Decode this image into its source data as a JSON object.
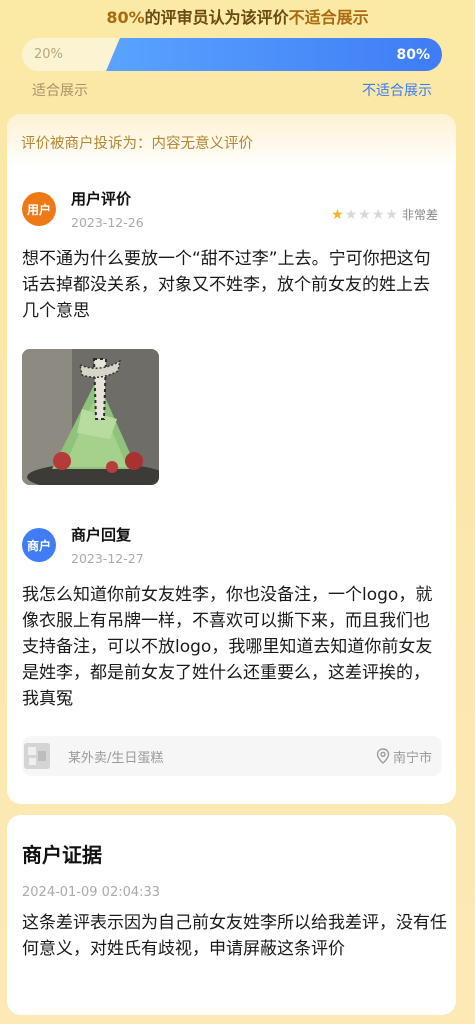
{
  "header": {
    "pct": "80%",
    "text": "的评审员认为该评价",
    "verdict": "不适合展示"
  },
  "vote": {
    "suitable_pct_label": "20%",
    "unsuitable_pct_label": "80%",
    "suitable_fraction": 0.2,
    "unsuitable_fraction": 0.8,
    "suitable_label": "适合展示",
    "unsuitable_label": "不适合展示"
  },
  "review": {
    "complaint": "评价被商户投诉为：内容无意义评价",
    "avatar_text": "用户",
    "name": "用户评价",
    "date": "2023-12-26",
    "rating": 1,
    "rating_max": 5,
    "rating_text": "非常差",
    "text": "想不通为什么要放一个“甜不过李”上去。宁可你把这句话去掉都没关系，对象又不姓李，放个前女友的姓上去几个意思"
  },
  "reply": {
    "avatar_text": "商户",
    "name": "商户回复",
    "date": "2023-12-27",
    "text": "我怎么知道你前女友姓李，你也没备注，一个logo，就像衣服上有吊牌一样，不喜欢可以撕下来，而且我们也支持备注，可以不放logo，我哪里知道去知道你前女友是姓李，都是前女友了姓什么还重要么，这差评挨的，我真冤"
  },
  "shop": {
    "name": "某外卖/生日蛋糕",
    "location": "南宁市"
  },
  "evidence": {
    "title": "商户证据",
    "date": "2024-01-09 02:04:33",
    "text": "这条差评表示因为自己前女友姓李所以给我差评，没有任何意义，对姓氏有歧视，申请屏蔽这条评价"
  },
  "colors": {
    "accent_blue": "#3f7cf5",
    "user_orange": "#ee7a17",
    "star_gold": "#f5b51a"
  }
}
